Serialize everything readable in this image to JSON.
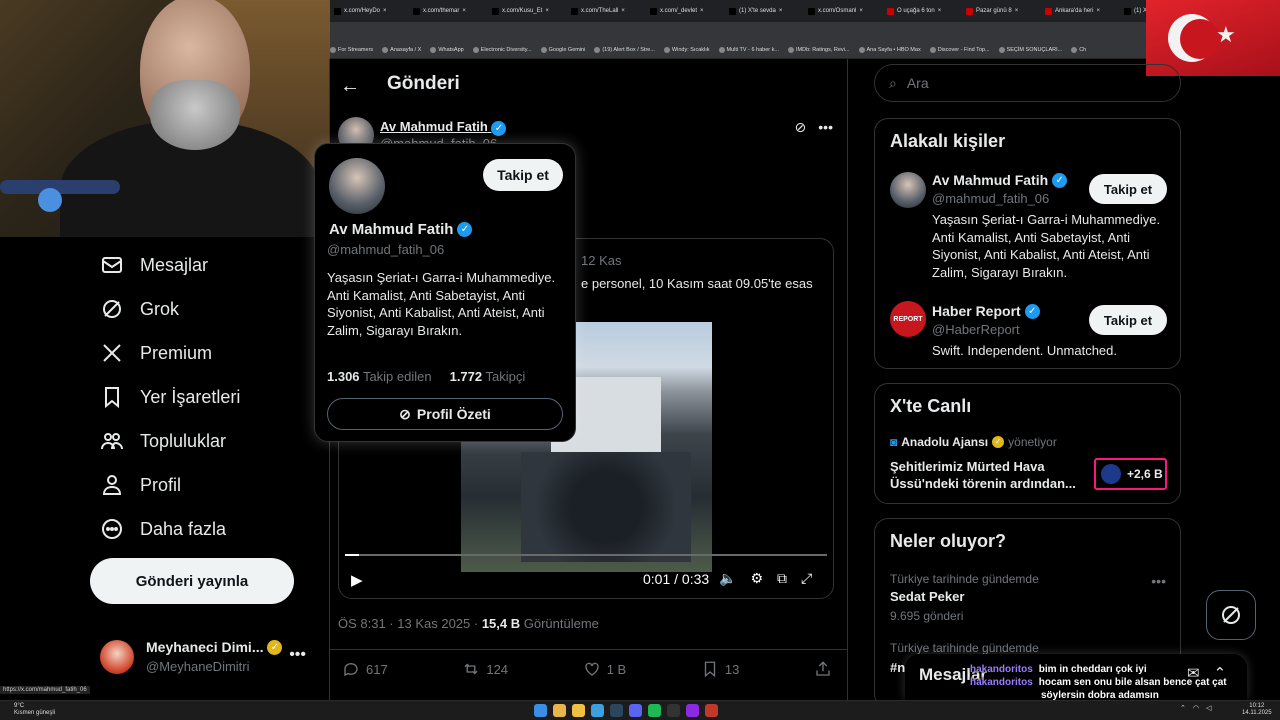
{
  "browser": {
    "tabs": [
      {
        "title": "x.com/HeyDo",
        "color": "#000000"
      },
      {
        "title": "x.com/themar",
        "color": "#000000"
      },
      {
        "title": "x.com/Kusu_Et",
        "color": "#000000"
      },
      {
        "title": "x.com/TheLall",
        "color": "#000000"
      },
      {
        "title": "x.com/_devlet",
        "color": "#000000"
      },
      {
        "title": "(1) X'te sevda",
        "color": "#000000"
      },
      {
        "title": "x.com/Osmanl",
        "color": "#000000"
      },
      {
        "title": "O uçağa 6 ton",
        "color": "#cc0000"
      },
      {
        "title": "Pazar günü 8",
        "color": "#cc0000"
      },
      {
        "title": "Ankara'da heri",
        "color": "#cc0000"
      },
      {
        "title": "(1) X'te Azad",
        "color": "#000000"
      }
    ],
    "bookmarks": [
      "For Streamers",
      "Anasayfa / X",
      "WhatsApp",
      "Electronic Diversity...",
      "Google Gemini",
      "(19) Alert Box / Stre...",
      "Windy: Sıcaklık",
      "Multi TV - 6 haber k...",
      "IMDb: Ratings, Revi...",
      "Ana Sayfa • HBO Max",
      "Discover - Find Top...",
      "SEÇİM SONUÇLARI...",
      "Ch"
    ],
    "status_url": "https://x.com/mahmud_fatih_06"
  },
  "nav": {
    "items": [
      {
        "label": "Mesajlar",
        "icon": "mail-icon"
      },
      {
        "label": "Grok",
        "icon": "grok-icon"
      },
      {
        "label": "Premium",
        "icon": "x-logo-icon"
      },
      {
        "label": "Yer İşaretleri",
        "icon": "bookmark-icon"
      },
      {
        "label": "Topluluklar",
        "icon": "people-icon"
      },
      {
        "label": "Profil",
        "icon": "person-icon"
      },
      {
        "label": "Daha fazla",
        "icon": "more-circle-icon"
      }
    ],
    "post_button": "Gönderi yayınla",
    "account": {
      "name": "Meyhaneci Dimi...",
      "handle": "@MeyhaneDimitri"
    }
  },
  "post": {
    "page_title": "Gönderi",
    "author_name": "Av Mahmud Fatih",
    "author_handle": "@mahmud_fatih_06",
    "quoted_date": "12 Kas",
    "quoted_text": "e personel, 10 Kasım saat 09.05'te esas",
    "video_time": "0:01 / 0:33",
    "video_progress": 0.03,
    "timestamp": "ÖS 8:31 · 13 Kas 2025 · ",
    "views": "15,4 B",
    "views_label": "Görüntüleme",
    "replies": "617",
    "reposts": "124",
    "likes": "1 B",
    "bookmarks": "13"
  },
  "hovercard": {
    "name": "Av Mahmud Fatih",
    "handle": "@mahmud_fatih_06",
    "follow": "Takip et",
    "bio": "Yaşasın Şeriat-ı Garra-i Muhammediye.\nAnti Kamalist, Anti Sabetayist, Anti Siyonist, Anti Kabalist, Anti Ateist, Anti Zalim, Sigarayı Bırakın.",
    "following_count": "1.306",
    "following_label": "Takip edilen",
    "followers_count": "1.772",
    "followers_label": "Takipçi",
    "summary_button": "Profil Özeti"
  },
  "right": {
    "search_placeholder": "Ara",
    "related_title": "Alakalı kişiler",
    "people": [
      {
        "name": "Av Mahmud Fatih",
        "handle": "@mahmud_fatih_06",
        "bio": "Yaşasın Şeriat-ı Garra-i Muhammediye. Anti Kamalist, Anti Sabetayist, Anti Siyonist, Anti Kabalist, Anti Ateist, Anti Zalim, Sigarayı Bırakın.",
        "follow": "Takip et"
      },
      {
        "name": "Haber Report",
        "handle": "@HaberReport",
        "bio": "Swift. Independent. Unmatched.",
        "follow": "Takip et",
        "avatar_text": "REPORT"
      }
    ],
    "live_title": "X'te Canlı",
    "live_source": "Anadolu Ajansı",
    "live_role": "yönetiyor",
    "live_headline": "Şehitlerimiz Mürted Hava Üssü'ndeki törenin ardından...",
    "live_count": "+2,6 B",
    "trends_title": "Neler oluyor?",
    "trends": [
      {
        "context": "Türkiye tarihinde gündemde",
        "title": "Sedat Peker",
        "count": "9.695 gönderi"
      },
      {
        "context": "Türkiye tarihinde gündemde",
        "title": "#n",
        "count": ""
      }
    ]
  },
  "drawer": {
    "title": "Mesajlar"
  },
  "chat": [
    {
      "user": "hakandoritos",
      "msg": "bim in cheddarı çok iyi"
    },
    {
      "user": "hakandoritos",
      "msg": "hocam sen onu bile alsan bence çat çat"
    },
    {
      "user": "",
      "msg": "söylersin dobra adamsın"
    }
  ],
  "taskbar": {
    "weather_temp": "9°C",
    "weather_desc": "Kısmen güneşli",
    "time": "10:12",
    "date": "14.11.2025"
  },
  "colors": {
    "accent": "#1d9bf0",
    "live_border": "#f91880",
    "bg": "#000000"
  }
}
